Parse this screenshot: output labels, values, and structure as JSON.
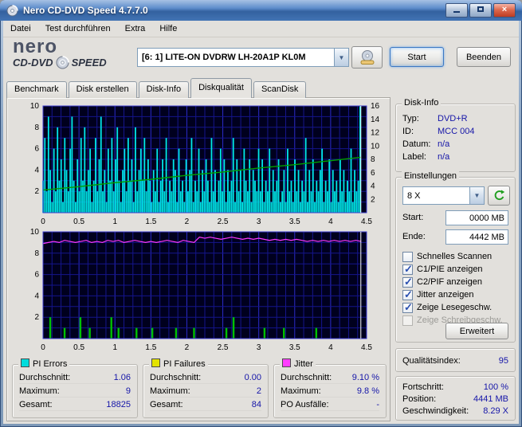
{
  "window": {
    "title": "Nero CD-DVD Speed 4.7.7.0"
  },
  "menu": {
    "items": [
      "Datei",
      "Test durchführen",
      "Extra",
      "Hilfe"
    ]
  },
  "logo": {
    "word": "nero",
    "sub1": "CD-DVD",
    "sub2": "SPEED"
  },
  "toolbar": {
    "drive": "[6: 1]  LITE-ON DVDRW LH-20A1P KL0M",
    "start_label": "Start",
    "quit_label": "Beenden"
  },
  "tabs": {
    "items": [
      "Benchmark",
      "Disk erstellen",
      "Disk-Info",
      "Diskqualität",
      "ScanDisk"
    ],
    "active": "Diskqualität"
  },
  "disk_info": {
    "title": "Disk-Info",
    "rows": [
      {
        "label": "Typ:",
        "value": "DVD+R"
      },
      {
        "label": "ID:",
        "value": "MCC 004"
      },
      {
        "label": "Datum:",
        "value": "n/a"
      },
      {
        "label": "Label:",
        "value": "n/a"
      }
    ]
  },
  "settings": {
    "title": "Einstellungen",
    "speed_select": "8 X",
    "start_label": "Start:",
    "start_value": "0000 MB",
    "end_label": "Ende:",
    "end_value": "4442 MB",
    "checkboxes": [
      {
        "label": "Schnelles Scannen",
        "checked": false,
        "disabled": false
      },
      {
        "label": "C1/PIE anzeigen",
        "checked": true,
        "disabled": false
      },
      {
        "label": "C2/PIF anzeigen",
        "checked": true,
        "disabled": false
      },
      {
        "label": "Jitter anzeigen",
        "checked": true,
        "disabled": false
      },
      {
        "label": "Zeige Lesegeschw.",
        "checked": true,
        "disabled": false
      },
      {
        "label": "Zeige Schreibgeschw.",
        "checked": false,
        "disabled": true
      }
    ],
    "advanced_label": "Erweitert"
  },
  "quality": {
    "label": "Qualitätsindex:",
    "value": "95"
  },
  "progress": {
    "rows": [
      {
        "label": "Fortschritt:",
        "value": "100 %"
      },
      {
        "label": "Position:",
        "value": "4441 MB"
      },
      {
        "label": "Geschwindigkeit:",
        "value": "8.29 X"
      }
    ]
  },
  "stats": [
    {
      "name": "PI Errors",
      "color": "#00dcdc",
      "rows": [
        {
          "label": "Durchschnitt:",
          "value": "1.06"
        },
        {
          "label": "Maximum:",
          "value": "9"
        },
        {
          "label": "Gesamt:",
          "value": "18825"
        }
      ]
    },
    {
      "name": "PI Failures",
      "color": "#e3e300",
      "rows": [
        {
          "label": "Durchschnitt:",
          "value": "0.00"
        },
        {
          "label": "Maximum:",
          "value": "2"
        },
        {
          "label": "Gesamt:",
          "value": "84"
        }
      ]
    },
    {
      "name": "Jitter",
      "color": "#ff3cff",
      "rows": [
        {
          "label": "Durchschnitt:",
          "value": "9.10 %"
        },
        {
          "label": "Maximum:",
          "value": "9.8 %"
        },
        {
          "label": "PO Ausfälle:",
          "value": "-"
        }
      ]
    }
  ],
  "chart_data": [
    {
      "type": "area",
      "title": "PI Errors with read speed overlay",
      "x_ticks": [
        0,
        0.5,
        1,
        1.5,
        2,
        2.5,
        3,
        3.5,
        4,
        4.5
      ],
      "x_max": 4.5,
      "y_left_ticks": [
        2,
        4,
        6,
        8,
        10
      ],
      "y_left_max": 10,
      "y_right_ticks": [
        2,
        4,
        6,
        8,
        10,
        12,
        14,
        16
      ],
      "y_right_max": 16,
      "pi_errors_x_step": 0.0252,
      "pi_errors": [
        3,
        7,
        2,
        9,
        4,
        1,
        6,
        2,
        8,
        3,
        5,
        1,
        7,
        4,
        2,
        6,
        9,
        3,
        1,
        5,
        2,
        7,
        3,
        8,
        2,
        4,
        6,
        1,
        3,
        7,
        2,
        5,
        9,
        2,
        4,
        1,
        6,
        3,
        7,
        2,
        5,
        8,
        3,
        1,
        4,
        6,
        2,
        7,
        3,
        5,
        1,
        8,
        2,
        4,
        6,
        3,
        7,
        2,
        5,
        3,
        1,
        4,
        2,
        6,
        1,
        3,
        5,
        2,
        7,
        1,
        3,
        2,
        5,
        4,
        1,
        6,
        2,
        3,
        1,
        5,
        2,
        4,
        7,
        1,
        3,
        2,
        6,
        1,
        4,
        2,
        5,
        3,
        1,
        7,
        2,
        4,
        1,
        3,
        6,
        2,
        5,
        1,
        4,
        2,
        3,
        7,
        1,
        5,
        2,
        4,
        1,
        6,
        3,
        2,
        5,
        1,
        4,
        3,
        2,
        6,
        2,
        5,
        1,
        3,
        2,
        6,
        1,
        4,
        2,
        3,
        5,
        1,
        2,
        4,
        1,
        6,
        2,
        3,
        1,
        5,
        2,
        4,
        1,
        3,
        2,
        7,
        1,
        4,
        2,
        5,
        1,
        3,
        2,
        4,
        6,
        1,
        3,
        2,
        5,
        1,
        4,
        2,
        3,
        1,
        5,
        2,
        4,
        1,
        3,
        2,
        6,
        1,
        4,
        2,
        3,
        10
      ],
      "speed_line": {
        "x": [
          0,
          0.5,
          1,
          1.5,
          2,
          2.5,
          3,
          3.5,
          4,
          4.42
        ],
        "v": [
          3.4,
          3.9,
          4.5,
          5.0,
          5.6,
          6.1,
          6.7,
          7.2,
          7.8,
          8.3
        ]
      },
      "cursor_x": 4.42
    },
    {
      "type": "line+bar",
      "title": "Jitter with PI Failures bars",
      "x_ticks": [
        0,
        0.5,
        1,
        1.5,
        2,
        2.5,
        3,
        3.5,
        4,
        4.5
      ],
      "x_max": 4.5,
      "y_left_ticks": [
        2,
        4,
        6,
        8,
        10
      ],
      "y_left_max": 10,
      "jitter_x_step": 0.075,
      "jitter": [
        8.9,
        9.0,
        9.1,
        9.0,
        9.2,
        9.1,
        9.0,
        9.1,
        9.2,
        9.0,
        9.1,
        9.0,
        9.2,
        9.1,
        9.2,
        9.0,
        9.1,
        9.2,
        9.1,
        9.0,
        9.1,
        9.0,
        9.1,
        9.2,
        9.1,
        9.0,
        9.2,
        9.1,
        9.0,
        9.5,
        9.4,
        9.5,
        9.4,
        9.3,
        9.4,
        9.5,
        9.4,
        9.3,
        9.4,
        9.3,
        9.4,
        9.3,
        9.2,
        9.3,
        9.2,
        9.3,
        9.2,
        9.3,
        9.2,
        9.1,
        9.2,
        9.1,
        9.2,
        9.1,
        9.2,
        9.1,
        9.2,
        9.1,
        9.2,
        9.1
      ],
      "pif": [
        {
          "x": 0.1,
          "h": 2
        },
        {
          "x": 0.3,
          "h": 1
        },
        {
          "x": 0.52,
          "h": 2
        },
        {
          "x": 0.65,
          "h": 1
        },
        {
          "x": 0.95,
          "h": 2
        },
        {
          "x": 1.05,
          "h": 1
        },
        {
          "x": 1.3,
          "h": 1
        },
        {
          "x": 1.52,
          "h": 1
        },
        {
          "x": 1.85,
          "h": 1
        },
        {
          "x": 2.1,
          "h": 1
        },
        {
          "x": 2.55,
          "h": 1
        },
        {
          "x": 2.65,
          "h": 2
        },
        {
          "x": 3.08,
          "h": 1
        },
        {
          "x": 3.35,
          "h": 1
        },
        {
          "x": 3.8,
          "h": 1
        }
      ],
      "cursor_x": 4.42
    }
  ]
}
